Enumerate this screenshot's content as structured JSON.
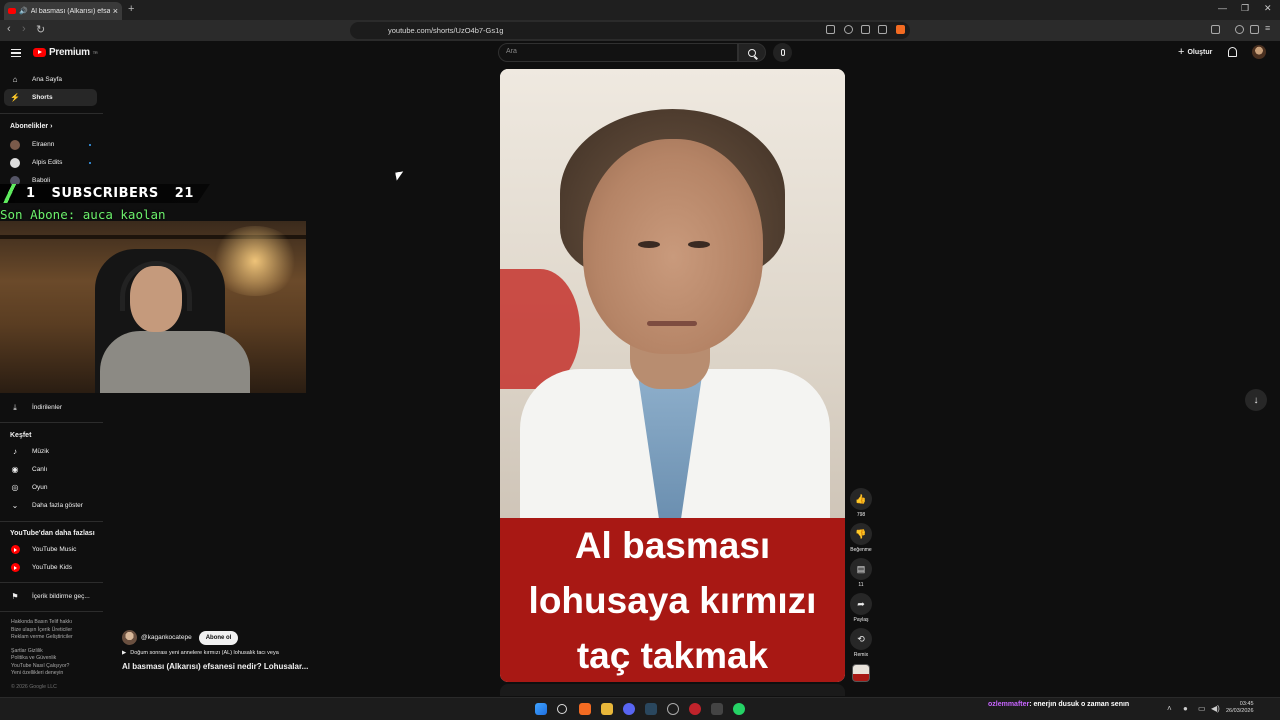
{
  "browser": {
    "tab_title": "Al basması (Alkarısı) efsanesi",
    "url": "youtube.com/shorts/UzO4b7-Gs1g"
  },
  "header": {
    "logo_text": "Premium",
    "logo_sup": "TR",
    "search_placeholder": "Ara",
    "create_label": "Oluştur"
  },
  "sidebar": {
    "home": "Ana Sayfa",
    "shorts": "Shorts",
    "subscriptions_head": "Abonelikler",
    "subs": [
      "Elraenn",
      "Alpis Edits",
      "Baboli"
    ],
    "downloads": "İndirilenler",
    "explore_head": "Keşfet",
    "explore": [
      "Müzik",
      "Canlı",
      "Oyun",
      "Daha fazla göster"
    ],
    "more_head": "YouTube'dan daha fazlası",
    "more": [
      "YouTube Music",
      "YouTube Kids"
    ],
    "report": "İçerik bildirme geç...",
    "footer1": "Hakkında  Basın  Telif hakkı",
    "footer2": "Bize ulaşın  İçerik Üreticiler",
    "footer3": "Reklam verme  Geliştiriciler",
    "footer4": "Şartlar  Gizlilik",
    "footer5": "Politika ve Güvenlik",
    "footer6": "YouTube Nasıl Çalışıyor?",
    "footer7": "Yeni özellikleri deneyin",
    "copyright": "© 2026 Google LLC"
  },
  "overlay": {
    "sub_count_left": "1",
    "sub_label": "SUBSCRIBERS",
    "sub_count_right": "21",
    "last_sub": "Son Abone: auca_kaolan"
  },
  "video": {
    "caption_lines": [
      "Al basması",
      "lohusaya kırmızı",
      "taç takmak"
    ],
    "channel": "@kagankocatepe",
    "subscribe": "Abone ol",
    "description": "Doğum sonrası yeni annelere kırmızı (AL) lohusalık tacı veya",
    "title": "Al basması (Alkarısı) efsanesi nedir? Lohusalar..."
  },
  "actions": {
    "like_count": "798",
    "dislike_label": "Beğenme",
    "comment_count": "11",
    "share_label": "Paylaş",
    "remix_label": "Remix"
  },
  "taskbar": {
    "chat_user": "ozlemmafter",
    "chat_text": ": enerjın dusuk o zaman senın",
    "time": "03:45",
    "date": "26/03/2026"
  }
}
